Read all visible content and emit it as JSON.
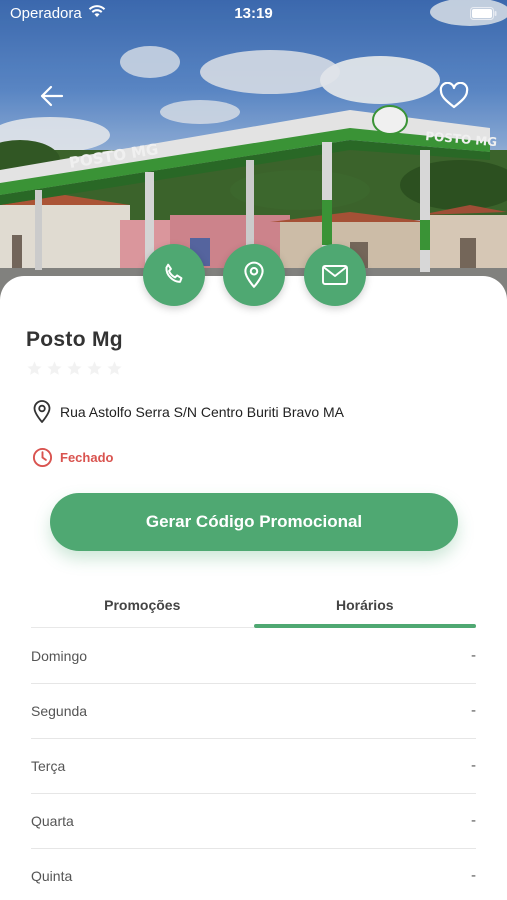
{
  "status_bar": {
    "carrier": "Operadora",
    "time": "13:19"
  },
  "place": {
    "name": "Posto Mg",
    "rating": 0,
    "address": "Rua Astolfo Serra S/N Centro Buriti Bravo MA",
    "status": "Fechado"
  },
  "photo_sign": {
    "canopy": "POSTO MG",
    "side": "POSTO MG"
  },
  "promo_button": "Gerar Código Promocional",
  "tabs": [
    {
      "label": "Promoções",
      "active": false
    },
    {
      "label": "Horários",
      "active": true
    }
  ],
  "hours": [
    {
      "day": "Domingo",
      "value": "-"
    },
    {
      "day": "Segunda",
      "value": "-"
    },
    {
      "day": "Terça",
      "value": "-"
    },
    {
      "day": "Quarta",
      "value": "-"
    },
    {
      "day": "Quinta",
      "value": "-"
    }
  ],
  "colors": {
    "accent": "#4fa872",
    "closed": "#d9534f"
  },
  "icons": [
    "back-arrow-icon",
    "heart-icon",
    "phone-icon",
    "map-pin-icon",
    "mail-icon",
    "star-icon",
    "location-icon",
    "clock-icon"
  ]
}
